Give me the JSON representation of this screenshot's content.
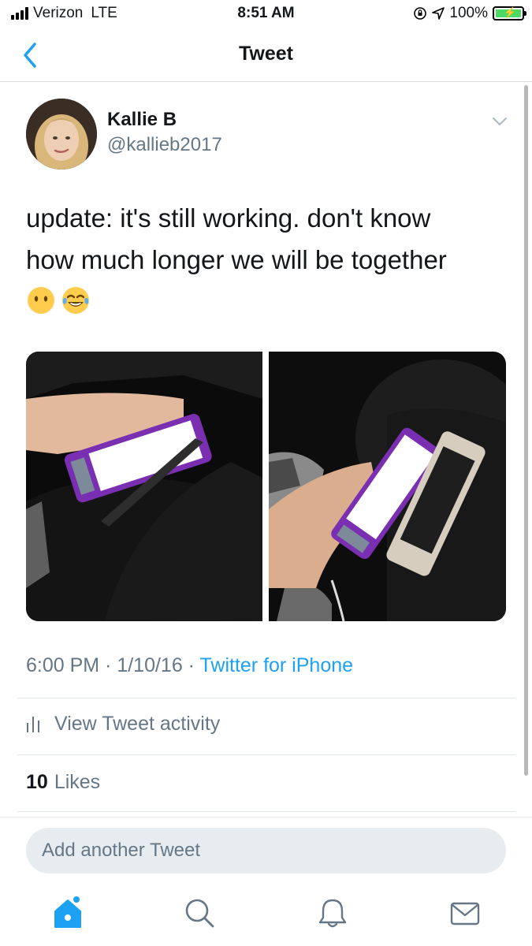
{
  "status_bar": {
    "carrier": "Verizon",
    "network": "LTE",
    "time": "8:51 AM",
    "battery_percent": "100%"
  },
  "nav": {
    "title": "Tweet",
    "back_icon": "chevron-left-icon"
  },
  "tweet": {
    "author_name": "Kallie B",
    "author_handle": "@kallieb2017",
    "text_line_1": "update: it's still working. don't know",
    "text_line_2": "how much longer we will be together",
    "emojis": [
      "neutral-face-no-mouth",
      "face-with-tears-of-joy"
    ],
    "timestamp": "6:00 PM · 1/10/16 · ",
    "source": "Twitter for iPhone",
    "activity_label": "View Tweet activity",
    "likes_count": "10",
    "likes_label": "Likes"
  },
  "reply": {
    "placeholder": "Add another Tweet"
  },
  "tab_bar": {
    "items": [
      "home-icon",
      "search-icon",
      "notifications-icon",
      "messages-icon"
    ],
    "active": "home-icon",
    "accent": "#1da1f2"
  },
  "colors": {
    "accent": "#1da1f2",
    "secondary_text": "#657786",
    "primary_text": "#14171a"
  }
}
